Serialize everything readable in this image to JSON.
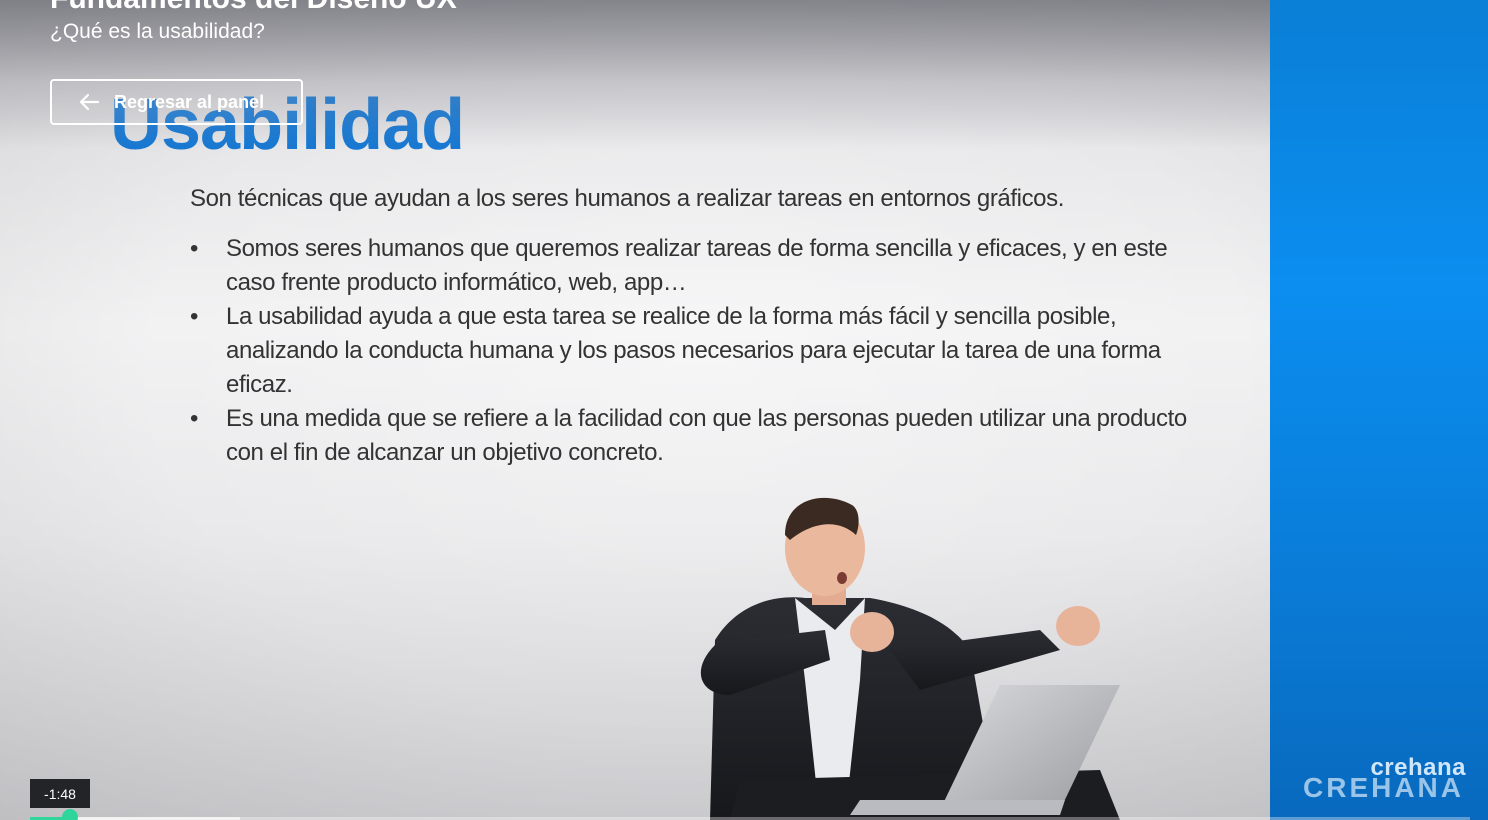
{
  "header": {
    "course_title": "Fundamentos del Diseño UX",
    "lesson_title": "¿Qué es la usabilidad?"
  },
  "back_button": {
    "label": "Regresar al panel",
    "icon": "arrow-left-icon"
  },
  "slide": {
    "heading": "Usabilidad",
    "intro": "Son técnicas que ayudan a los seres humanos a realizar tareas en entornos gráficos.",
    "bullets": [
      "Somos seres humanos que queremos realizar tareas de forma sencilla y eficaces, y en este caso frente producto informático, web, app…",
      "La usabilidad ayuda a que esta tarea se realice de la forma más fácil y sencilla posible, analizando la conducta humana y los pasos necesarios para ejecutar la tarea de una forma eficaz.",
      "Es una medida que se refiere a la facilidad con que las personas pueden utilizar una producto con el fin de alcanzar un objetivo concreto."
    ]
  },
  "branding": {
    "small": "crehana",
    "big": "CREHANA"
  },
  "player": {
    "time_remaining": "-1:48",
    "progress_fraction": 0.028,
    "buffered_fraction": 0.146,
    "accent_color": "#2fd59a"
  },
  "colors": {
    "heading_blue": "#1778d2",
    "panel_blue": "#0b8ef0"
  }
}
